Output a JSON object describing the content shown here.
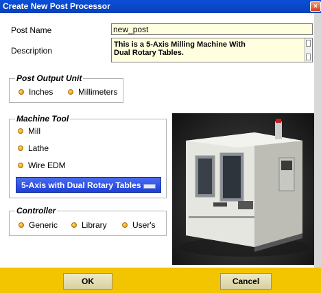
{
  "window": {
    "title": "Create New Post Processor",
    "close_glyph": "×"
  },
  "form": {
    "post_name_label": "Post Name",
    "post_name_value": "new_post",
    "description_label": "Description",
    "description_line1": "This is a 5-Axis Milling Machine With",
    "description_line2": "Dual Rotary Tables."
  },
  "post_output_unit": {
    "title": "Post Output Unit",
    "options": [
      "Inches",
      "Millimeters"
    ],
    "selected": "Millimeters"
  },
  "machine_tool": {
    "title": "Machine Tool",
    "options": [
      "Mill",
      "Lathe",
      "Wire EDM"
    ],
    "selected": "Mill",
    "config_value": "5-Axis with Dual Rotary Tables"
  },
  "controller": {
    "title": "Controller",
    "options": [
      "Generic",
      "Library",
      "User's"
    ],
    "selected": "Generic"
  },
  "footer": {
    "ok_label": "OK",
    "cancel_label": "Cancel"
  },
  "colors": {
    "titlebar": "#0a4fd8",
    "footer": "#f3c400",
    "dropdown": "#2a4ce0",
    "radio": "#f0a000",
    "input_bg": "#ffffe0"
  }
}
